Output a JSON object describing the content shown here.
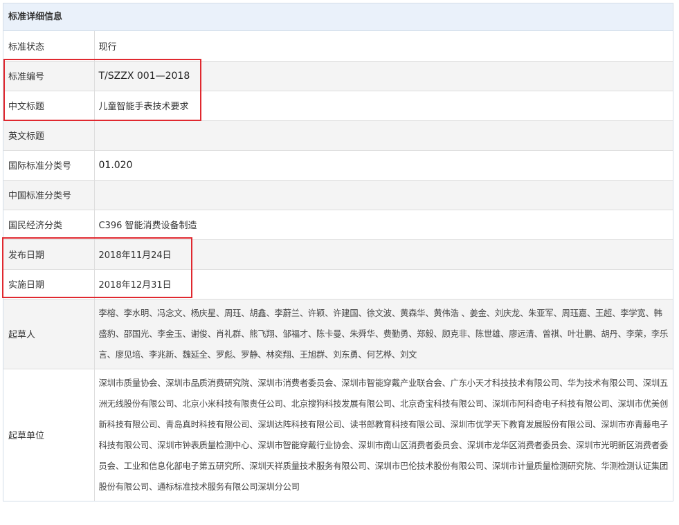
{
  "panel": {
    "title": "标准详细信息"
  },
  "rows": {
    "status": {
      "label": "标准状态",
      "value": "现行"
    },
    "number": {
      "label": "标准编号",
      "value": "T/SZZX 001—2018"
    },
    "cn_title": {
      "label": "中文标题",
      "value": "儿童智能手表技术要求"
    },
    "en_title": {
      "label": "英文标题",
      "value": ""
    },
    "ics": {
      "label": "国际标准分类号",
      "value": "01.020"
    },
    "ccs": {
      "label": "中国标准分类号",
      "value": ""
    },
    "economy": {
      "label": "国民经济分类",
      "value": "C396 智能消费设备制造"
    },
    "publish_date": {
      "label": "发布日期",
      "value": "2018年11月24日"
    },
    "effective_date": {
      "label": "实施日期",
      "value": "2018年12月31日"
    },
    "drafters": {
      "label": "起草人",
      "value": "李榕、李水明、冯念文、杨庆星、周珏、胡鑫、李蔚兰、许颖、许建国、徐文波、黄森华、黄伟浩 、姜金、刘庆龙、朱亚军、周珏嘉、王超、李学宽、韩盛豹、邵国光、李金玉、谢俊、肖礼群、熊飞翔、邹福才、陈卡曼、朱舜华、费勤勇、郑毅、顾克非、陈世雄、廖远清、曾祺、叶壮鹏、胡丹、李荣，李乐言、廖见培、李兆新、魏延全、罗彪、罗静、林奕翔、王旭群、刘东勇、何艺桦、刘文"
    },
    "drafting_units": {
      "label": "起草单位",
      "value": "深圳市质量协会、深圳市品质消费研究院、深圳市消费者委员会、深圳市智能穿戴产业联合会、广东小天才科技技术有限公司、华为技术有限公司、深圳五洲无线股份有限公司、北京小米科技有限责任公司、北京搜狗科技发展有限公司、北京奇宝科技有限公司、深圳市阿科奇电子科技有限公司、深圳市优美创新科技有限公司、青岛真时科技有限公司、深圳达阵科技有限公司、读书郎教育科技有限公司、深圳市优学天下教育发展股份有限公司、深圳市亦青藤电子科技有限公司、深圳市钟表质量检测中心、深圳市智能穿戴行业协会、深圳市南山区消费者委员会、深圳市龙华区消费者委员会、深圳市光明新区消费者委员会、工业和信息化部电子第五研究所、深圳天祥质量技术服务有限公司、深圳市巴伦技术股份有限公司、深圳市计量质量检测研究院、华测检测认证集团股份有限公司、通标标准技术服务有限公司深圳分公司"
    }
  },
  "annotation_color": "#e0282f"
}
